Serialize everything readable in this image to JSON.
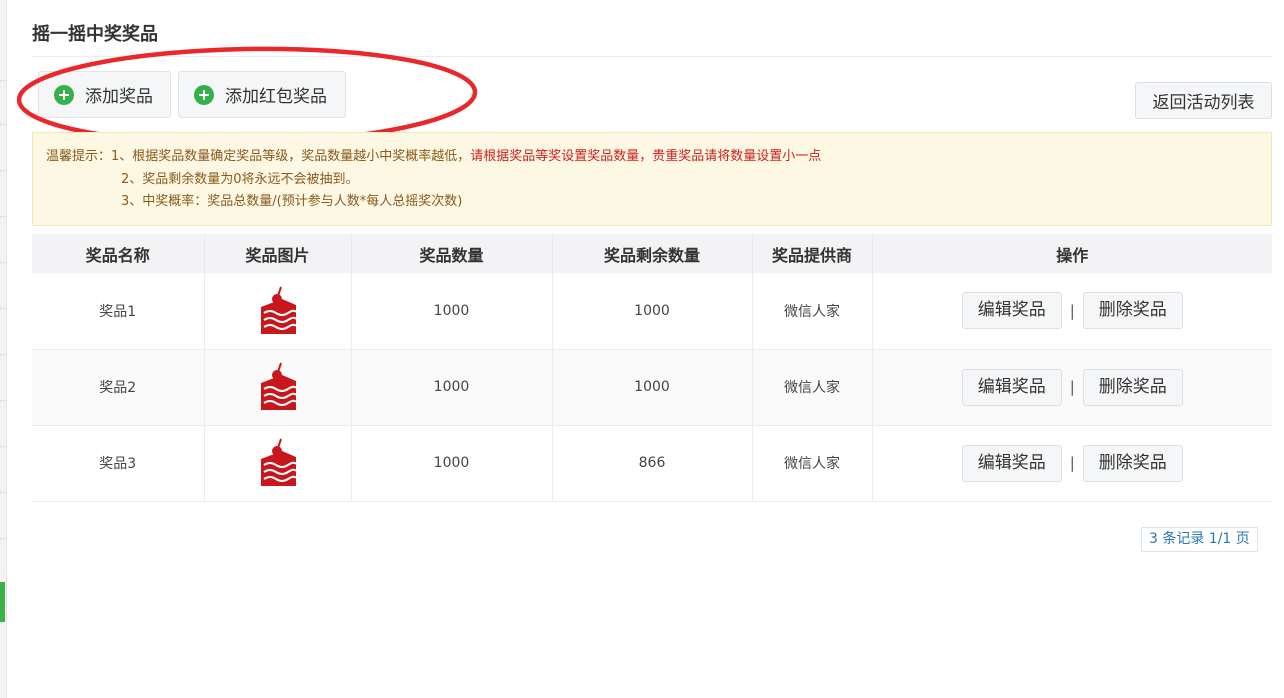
{
  "page": {
    "title": "摇一摇中奖奖品"
  },
  "toolbar": {
    "add_prize_label": "添加奖品",
    "add_redpacket_label": "添加红包奖品",
    "return_label": "返回活动列表"
  },
  "tips": {
    "prefix": "温馨提示：",
    "line1_normal": "1、根据奖品数量确定奖品等级，奖品数量越小中奖概率越低，",
    "line1_red": "请根据奖品等奖设置奖品数量，贵重奖品请将数量设置小一点",
    "line2": "2、奖品剩余数量为0将永远不会被抽到。",
    "line3": "3、中奖概率：奖品总数量/(预计参与人数*每人总摇奖次数)"
  },
  "table": {
    "headers": [
      "奖品名称",
      "奖品图片",
      "奖品数量",
      "奖品剩余数量",
      "奖品提供商",
      "操作"
    ],
    "rows": [
      {
        "name": "奖品1",
        "icon": "cake-icon",
        "quantity": "1000",
        "remaining": "1000",
        "provider": "微信人家"
      },
      {
        "name": "奖品2",
        "icon": "cake-icon",
        "quantity": "1000",
        "remaining": "1000",
        "provider": "微信人家"
      },
      {
        "name": "奖品3",
        "icon": "cake-icon",
        "quantity": "1000",
        "remaining": "866",
        "provider": "微信人家"
      }
    ],
    "edit_label": "编辑奖品",
    "delete_label": "删除奖品",
    "separator": "|"
  },
  "pager": {
    "text": "3 条记录 1/1 页"
  },
  "colors": {
    "accent_green": "#36b04a",
    "annotation_red": "#e8282b",
    "icon_red": "#c8161d",
    "tip_red": "#d0201c",
    "pager_blue": "#2a78b5"
  }
}
